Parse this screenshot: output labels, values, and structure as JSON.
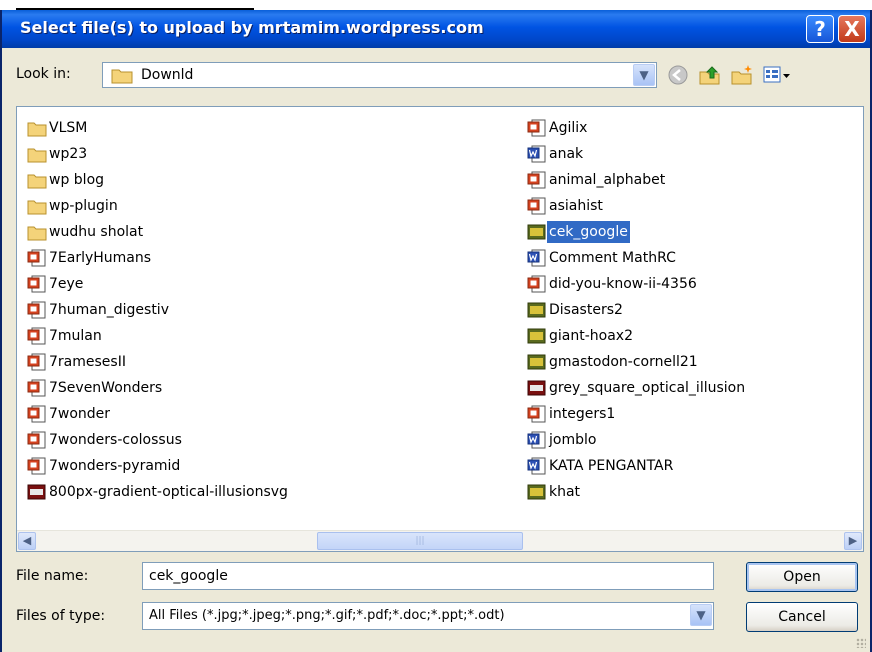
{
  "window": {
    "title": "Select file(s) to upload by mrtamim.wordpress.com",
    "help_glyph": "?",
    "close_glyph": "X"
  },
  "lookin": {
    "label": "Look in:",
    "value": "Downld"
  },
  "files_left": [
    {
      "name": "VLSM",
      "icon": "folder-icon"
    },
    {
      "name": "wp23",
      "icon": "folder-icon"
    },
    {
      "name": "wp blog",
      "icon": "folder-icon"
    },
    {
      "name": "wp-plugin",
      "icon": "folder-icon"
    },
    {
      "name": "wudhu sholat",
      "icon": "folder-icon"
    },
    {
      "name": "7EarlyHumans",
      "icon": "ppt-icon"
    },
    {
      "name": "7eye",
      "icon": "ppt-icon"
    },
    {
      "name": "7human_digestiv",
      "icon": "ppt-icon"
    },
    {
      "name": "7mulan",
      "icon": "ppt-icon"
    },
    {
      "name": "7ramesesII",
      "icon": "ppt-icon"
    },
    {
      "name": "7SevenWonders",
      "icon": "ppt-icon"
    },
    {
      "name": "7wonder",
      "icon": "ppt-icon"
    },
    {
      "name": "7wonders-colossus",
      "icon": "ppt-icon"
    },
    {
      "name": "7wonders-pyramid",
      "icon": "ppt-icon"
    },
    {
      "name": "800px-gradient-optical-illusionsvg",
      "icon": "png-icon"
    }
  ],
  "files_right": [
    {
      "name": "Agilix",
      "icon": "ppt-icon"
    },
    {
      "name": "anak",
      "icon": "word-icon"
    },
    {
      "name": "animal_alphabet",
      "icon": "ppt-icon"
    },
    {
      "name": "asiahist",
      "icon": "ppt-icon"
    },
    {
      "name": "cek_google",
      "icon": "jpg-icon",
      "selected": true
    },
    {
      "name": "Comment MathRC",
      "icon": "word-icon"
    },
    {
      "name": "did-you-know-ii-4356",
      "icon": "ppt-icon"
    },
    {
      "name": "Disasters2",
      "icon": "jpg-icon"
    },
    {
      "name": "giant-hoax2",
      "icon": "jpg-icon"
    },
    {
      "name": "gmastodon-cornell21",
      "icon": "jpg-icon"
    },
    {
      "name": "grey_square_optical_illusion",
      "icon": "png-icon"
    },
    {
      "name": "integers1",
      "icon": "ppt-icon"
    },
    {
      "name": "jomblo",
      "icon": "word-icon"
    },
    {
      "name": "KATA PENGANTAR",
      "icon": "word-icon"
    },
    {
      "name": "khat",
      "icon": "jpg-icon"
    }
  ],
  "filename": {
    "label": "File name:",
    "value": "cek_google"
  },
  "filetype": {
    "label": "Files of type:",
    "value": "All Files (*.jpg;*.jpeg;*.png;*.gif;*.pdf;*.doc;*.ppt;*.odt)"
  },
  "buttons": {
    "open": "Open",
    "cancel": "Cancel"
  }
}
